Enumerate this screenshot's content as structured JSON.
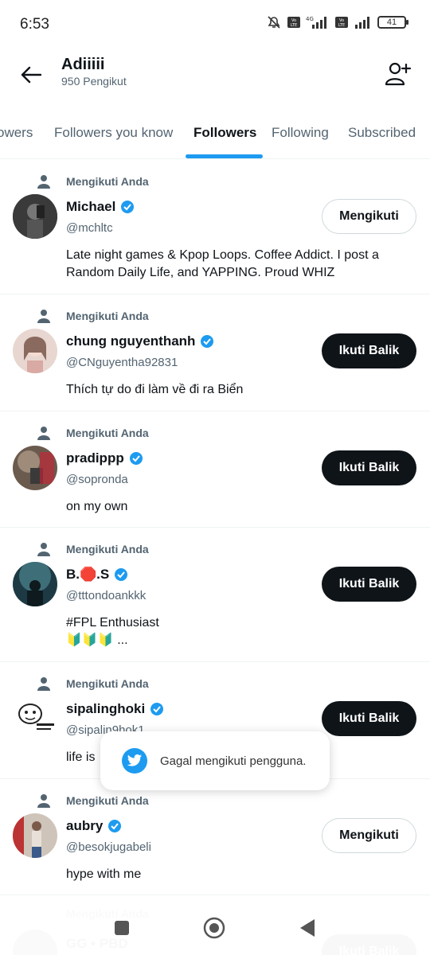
{
  "status_bar": {
    "time": "6:53",
    "battery": "41",
    "network": "4G"
  },
  "header": {
    "title": "Adiiiii",
    "subtitle": "950 Pengikut"
  },
  "tabs": [
    "owers",
    "Followers you know",
    "Followers",
    "Following",
    "Subscribed"
  ],
  "active_tab": "Followers",
  "follows_you_label": "Mengikuti Anda",
  "users": [
    {
      "name": "Michael",
      "handle": "@mchltc",
      "bio": "Late night games & Kpop Loops. Coffee Addict. I post a Random Daily Life, and YAPPING. Proud WHIZ",
      "button": "Mengikuti",
      "verified": true
    },
    {
      "name": "chung nguyenthanh",
      "handle": "@CNguyentha92831",
      "bio": "Thích tự do đi làm về đi ra Biển",
      "button": "Ikuti Balik",
      "verified": true
    },
    {
      "name": "pradippp",
      "handle": "@sopronda",
      "bio": "on my own",
      "button": "Ikuti Balik",
      "verified": true
    },
    {
      "name": "B.🛑.S",
      "handle": "@tttondoankkk",
      "bio": "#FPL Enthusiast\n🔰🔰🔰 ...",
      "button": "Ikuti Balik",
      "verified": true
    },
    {
      "name": "sipalinghoki",
      "handle": "@sipalin9hok1",
      "bio": "life is",
      "button": "Ikuti Balik",
      "verified": true
    },
    {
      "name": "aubry",
      "handle": "@besokjugabeli",
      "bio": "hype with me",
      "button": "Mengikuti",
      "verified": true
    }
  ],
  "partial_user": {
    "name": "GG",
    "extra": "PBD",
    "button": "Ikuti Balik"
  },
  "toast": {
    "message": "Gagal mengikuti pengguna."
  },
  "colors": {
    "accent": "#1d9bf0",
    "text": "#0f1419",
    "muted": "#536471"
  }
}
